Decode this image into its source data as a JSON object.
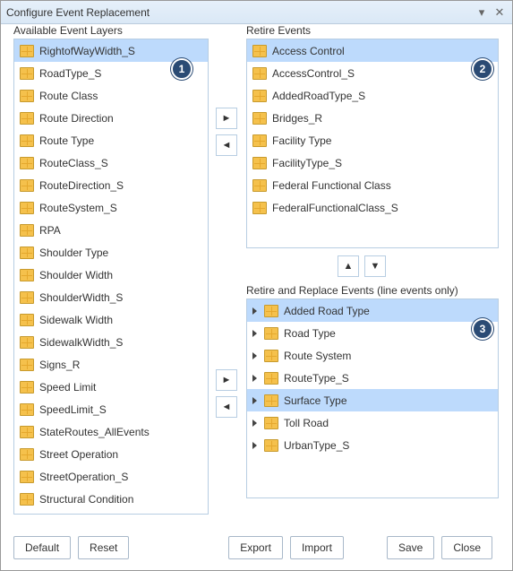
{
  "window": {
    "title": "Configure Event Replacement"
  },
  "labels": {
    "available": "Available Event Layers",
    "retire": "Retire Events",
    "retire_replace": "Retire and Replace Events (line events only)"
  },
  "callouts": {
    "c1": "1",
    "c2": "2",
    "c3": "3"
  },
  "available": {
    "selected_index": 0,
    "items": [
      {
        "label": "RightofWayWidth_S"
      },
      {
        "label": "RoadType_S"
      },
      {
        "label": "Route Class"
      },
      {
        "label": "Route Direction"
      },
      {
        "label": "Route Type"
      },
      {
        "label": "RouteClass_S"
      },
      {
        "label": "RouteDirection_S"
      },
      {
        "label": "RouteSystem_S"
      },
      {
        "label": "RPA"
      },
      {
        "label": "Shoulder Type"
      },
      {
        "label": "Shoulder Width"
      },
      {
        "label": "ShoulderWidth_S"
      },
      {
        "label": "Sidewalk Width"
      },
      {
        "label": "SidewalkWidth_S"
      },
      {
        "label": "Signs_R"
      },
      {
        "label": "Speed Limit"
      },
      {
        "label": "SpeedLimit_S"
      },
      {
        "label": "StateRoutes_AllEvents"
      },
      {
        "label": "Street Operation"
      },
      {
        "label": "StreetOperation_S"
      },
      {
        "label": "Structural Condition"
      }
    ]
  },
  "retire": {
    "selected_index": 0,
    "items": [
      {
        "label": "Access Control"
      },
      {
        "label": "AccessControl_S"
      },
      {
        "label": "AddedRoadType_S"
      },
      {
        "label": "Bridges_R"
      },
      {
        "label": "Facility Type"
      },
      {
        "label": "FacilityType_S"
      },
      {
        "label": "Federal Functional Class"
      },
      {
        "label": "FederalFunctionalClass_S"
      }
    ]
  },
  "retire_replace": {
    "selected_indices": [
      0,
      4
    ],
    "items": [
      {
        "label": "Added Road Type"
      },
      {
        "label": "Road Type"
      },
      {
        "label": "Route System"
      },
      {
        "label": "RouteType_S"
      },
      {
        "label": "Surface Type"
      },
      {
        "label": "Toll Road"
      },
      {
        "label": "UrbanType_S"
      }
    ]
  },
  "buttons": {
    "default": "Default",
    "reset": "Reset",
    "export": "Export",
    "import": "Import",
    "save": "Save",
    "close": "Close"
  },
  "icons": {
    "move_right": "►",
    "move_left": "◄",
    "move_up": "▲",
    "move_down": "▼",
    "collapse": "▾",
    "close": "✕"
  }
}
